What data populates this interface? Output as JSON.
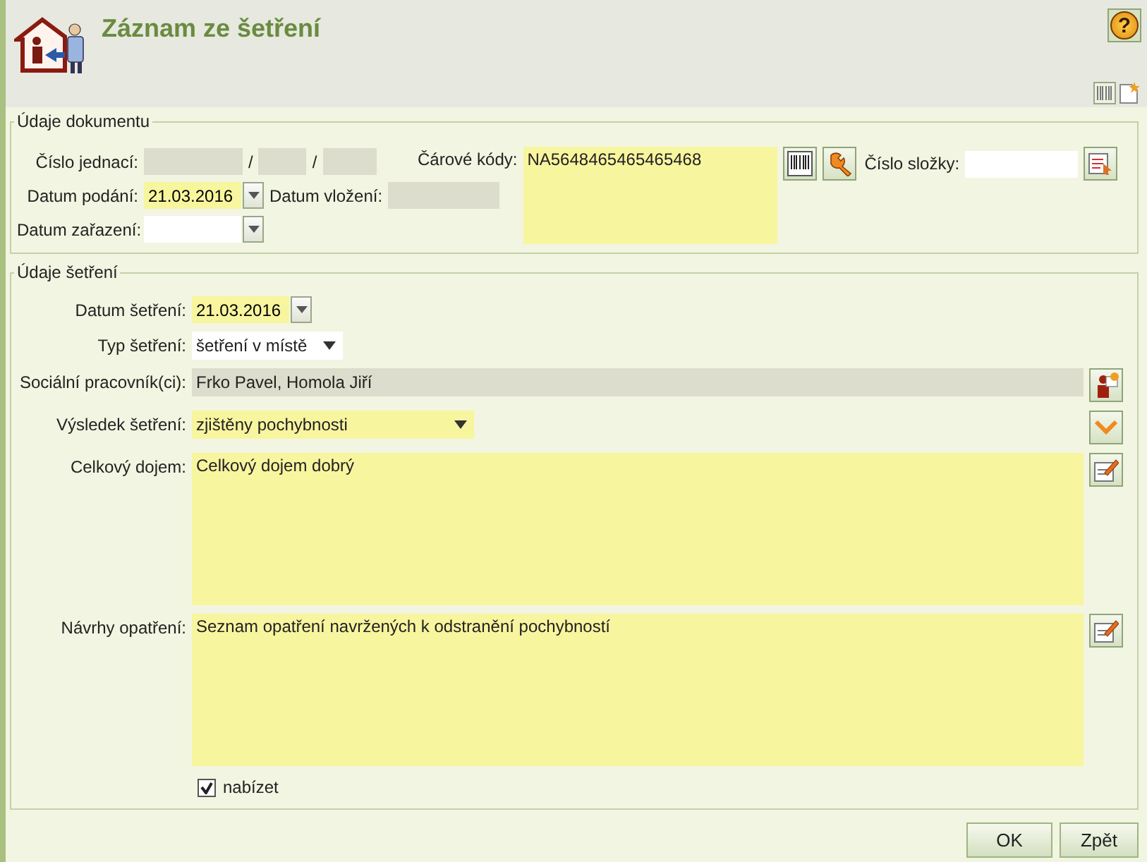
{
  "window": {
    "title": "Záznam ze šetření",
    "help": "?"
  },
  "document_section": {
    "legend": "Údaje dokumentu",
    "case_number": {
      "label": "Číslo jednací:",
      "separators": [
        "/",
        "/"
      ]
    },
    "filed_date": {
      "label": "Datum podání:",
      "value": "21.03.2016"
    },
    "inserted_date": {
      "label": "Datum vložení:"
    },
    "classified_date": {
      "label": "Datum zařazení:"
    },
    "barcodes": {
      "label": "Čárové kódy:",
      "value": "NA5648465465465468"
    },
    "folder_number": {
      "label": "Číslo složky:"
    }
  },
  "examination_section": {
    "legend": "Údaje šetření",
    "date": {
      "label": "Datum šetření:",
      "value": "21.03.2016"
    },
    "type": {
      "label": "Typ šetření:",
      "value": "šetření v místě"
    },
    "workers": {
      "label": "Sociální pracovník(ci):",
      "value": "Frko Pavel, Homola Jiří"
    },
    "result": {
      "label": "Výsledek šetření:",
      "value": "zjištěny pochybnosti"
    },
    "impression": {
      "label": "Celkový dojem:",
      "value": "Celkový dojem dobrý"
    },
    "proposals": {
      "label": "Návrhy opatření:",
      "value": "Seznam opatření navržených k odstranění pochybností"
    },
    "offer": {
      "label": "nabízet",
      "checked": true
    }
  },
  "buttons": [
    "OK",
    "Zpět"
  ]
}
